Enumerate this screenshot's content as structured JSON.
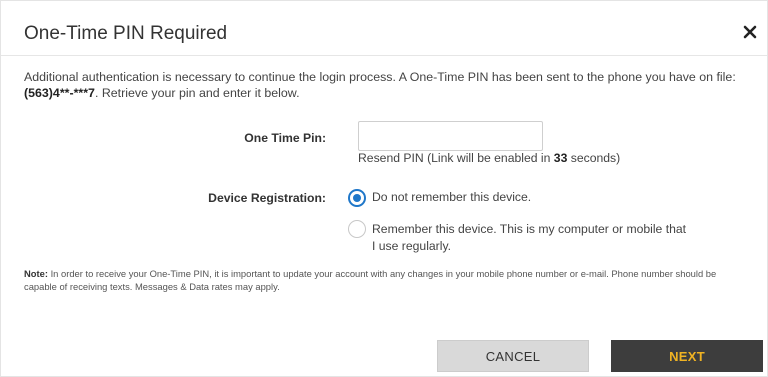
{
  "dialog": {
    "title": "One-Time PIN Required",
    "close_icon": "close-icon"
  },
  "intro": {
    "text_before": "Additional authentication is necessary to continue the login process. A One-Time PIN has been sent to the phone you have on file: ",
    "phone": "(563)4**-***7",
    "text_after": ". Retrieve your pin and enter it below."
  },
  "pin": {
    "label": "One Time Pin:",
    "value": "",
    "placeholder": "",
    "resend_before": "Resend PIN (Link will be enabled in ",
    "resend_seconds": "33",
    "resend_after": " seconds)"
  },
  "device": {
    "label": "Device Registration:",
    "options": [
      {
        "label": "Do not remember this device.",
        "checked": true
      },
      {
        "label": "Remember this device. This is my computer or mobile that I use regularly.",
        "checked": false
      }
    ]
  },
  "note": {
    "prefix": "Note:",
    "text": " In order to receive your One-Time PIN, it is important to update your account with any changes in your mobile phone number or e-mail. Phone number should be capable of receiving texts. Messages & Data rates may apply."
  },
  "buttons": {
    "cancel": "CANCEL",
    "next": "NEXT"
  },
  "colors": {
    "accent": "#1f77c9",
    "next_bg": "#3d3d3d",
    "next_text": "#f0b323"
  }
}
